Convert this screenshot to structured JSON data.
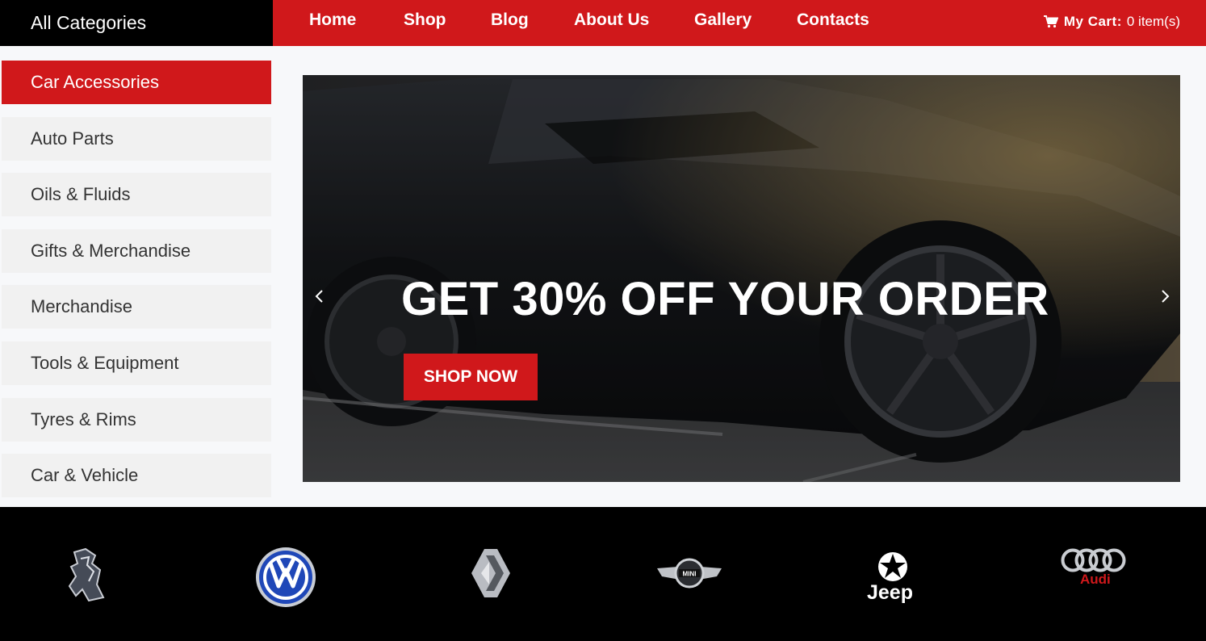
{
  "header": {
    "categories_title": "All Categories",
    "nav": [
      "Home",
      "Shop",
      "Blog",
      "About Us",
      "Gallery",
      "Contacts"
    ],
    "cart_label": "My Cart:",
    "cart_count": "0 item(s)",
    "cart_icon": "cart-icon"
  },
  "sidebar": {
    "items": [
      {
        "label": "Car Accessories",
        "active": true
      },
      {
        "label": "Auto Parts"
      },
      {
        "label": "Oils & Fluids"
      },
      {
        "label": "Gifts & Merchandise"
      },
      {
        "label": "Merchandise"
      },
      {
        "label": "Tools & Equipment"
      },
      {
        "label": "Tyres & Rims"
      },
      {
        "label": "Car & Vehicle"
      }
    ]
  },
  "hero": {
    "title": "GET 30% OFF YOUR ORDER",
    "button": "SHOP NOW",
    "prev_icon": "chevron-left-icon",
    "next_icon": "chevron-right-icon"
  },
  "brands": {
    "items": [
      "peugeot-logo",
      "volkswagen-logo",
      "renault-logo",
      "mini-logo",
      "jeep-logo",
      "audi-logo"
    ],
    "mini_text": "MINI",
    "jeep_text": "Jeep",
    "audi_text": "Audi"
  },
  "colors": {
    "accent": "#d0181b",
    "dark": "#000000",
    "sidebar_bg": "#f1f1f1"
  }
}
